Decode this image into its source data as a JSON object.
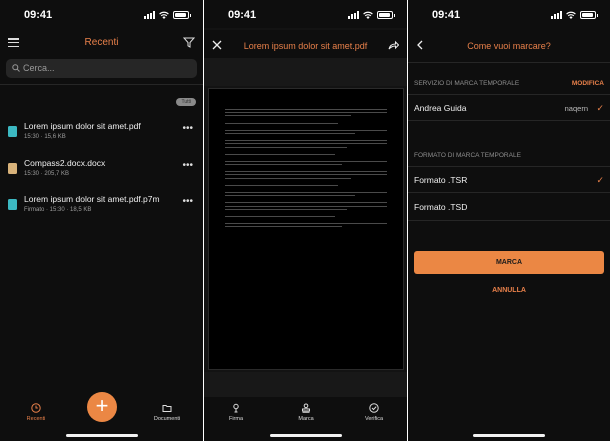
{
  "status_time": "09:41",
  "screen1": {
    "title": "Recenti",
    "search_placeholder": "Cerca...",
    "pill_label": "Tutti",
    "files": [
      {
        "name": "Lorem ipsum dolor sit amet.pdf",
        "meta": "15:30 · 15,6 KB",
        "icon": "pdf-icon",
        "color": "#3cb9c2"
      },
      {
        "name": "Compass2.docx.docx",
        "meta": "15:30 · 205,7 KB",
        "icon": "word-icon",
        "color": "#d8b27a"
      },
      {
        "name": "Lorem ipsum dolor sit amet.pdf.p7m",
        "meta": "Firmato · 15:30 · 18,5 KB",
        "icon": "signed-file-icon",
        "color": "#3cb9c2"
      }
    ],
    "more_label": "•••",
    "tabs": [
      {
        "label": "Recenti",
        "icon": "clock-icon",
        "active": true
      },
      {
        "label": "Documenti",
        "icon": "folder-icon",
        "active": false
      }
    ],
    "fab_label": "+"
  },
  "screen2": {
    "title": "Lorem ipsum dolor sit amet.pdf",
    "tabs": [
      {
        "label": "Firma",
        "icon": "pen-icon"
      },
      {
        "label": "Marca",
        "icon": "stamp-icon"
      },
      {
        "label": "Verifica",
        "icon": "check-circle-icon"
      }
    ]
  },
  "screen3": {
    "title": "Come vuoi marcare?",
    "service_label": "SERVIZIO DI MARCA TEMPORALE",
    "modify_label": "MODIFICA",
    "service_name": "Andrea Guida",
    "service_user": "naqern",
    "format_label": "FORMATO DI MARCA TEMPORALE",
    "formats": [
      {
        "label": "Formato .TSR",
        "selected": true
      },
      {
        "label": "Formato .TSD",
        "selected": false
      }
    ],
    "check_glyph": "✓",
    "marca_button": "MARCA",
    "annulla_button": "ANNULLA"
  },
  "colors": {
    "accent": "#eb8744",
    "background": "#0e0e0e"
  }
}
